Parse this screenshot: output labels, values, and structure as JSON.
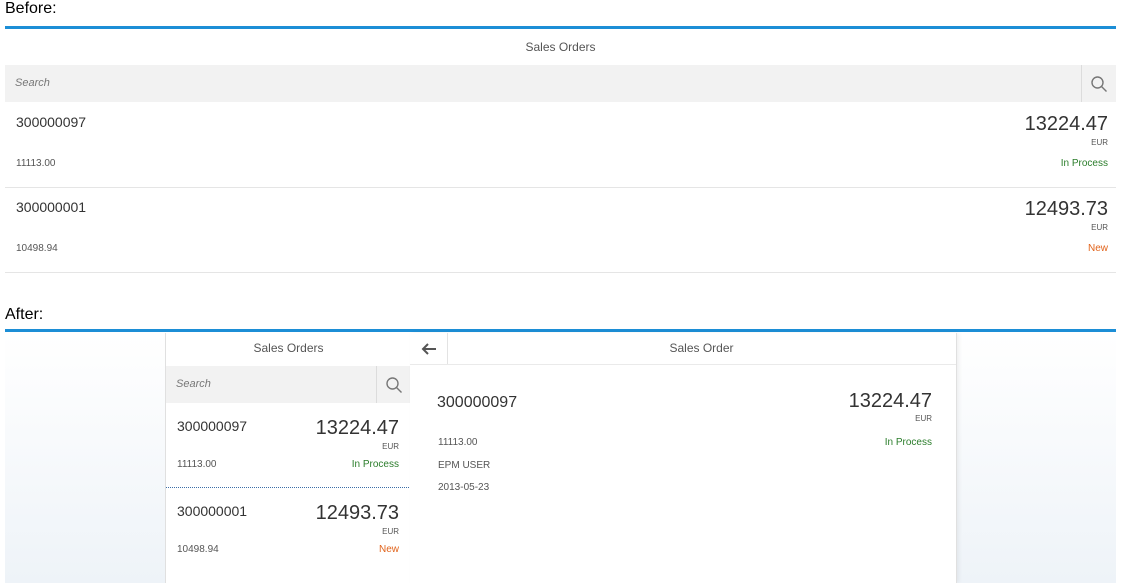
{
  "captions": {
    "before": "Before:",
    "after": "After:"
  },
  "colors": {
    "accent_line": "#1c8ed6",
    "in_process": "#2b7d2b",
    "new": "#e1631b"
  },
  "before": {
    "title": "Sales Orders",
    "search": {
      "placeholder": "Search",
      "icon": "search-icon"
    },
    "orders": [
      {
        "id": "300000097",
        "net": "11113.00",
        "amount": "13224.47",
        "currency": "EUR",
        "status": "In Process",
        "status_color": "#2b7d2b"
      },
      {
        "id": "300000001",
        "net": "10498.94",
        "amount": "12493.73",
        "currency": "EUR",
        "status": "New",
        "status_color": "#e1631b"
      }
    ]
  },
  "after": {
    "master": {
      "title": "Sales Orders",
      "search": {
        "placeholder": "Search",
        "icon": "search-icon"
      },
      "orders": [
        {
          "id": "300000097",
          "net": "11113.00",
          "amount": "13224.47",
          "currency": "EUR",
          "status": "In Process",
          "status_color": "#2b7d2b"
        },
        {
          "id": "300000001",
          "net": "10498.94",
          "amount": "12493.73",
          "currency": "EUR",
          "status": "New",
          "status_color": "#e1631b"
        }
      ]
    },
    "detail": {
      "back_icon": "arrow-left-icon",
      "title": "Sales Order",
      "id": "300000097",
      "amount": "13224.47",
      "currency": "EUR",
      "net": "11113.00",
      "status": "In Process",
      "user": "EPM USER",
      "date": "2013-05-23"
    }
  }
}
